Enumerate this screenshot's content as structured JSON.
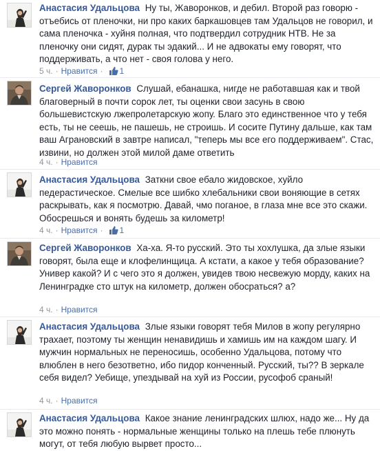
{
  "comments": [
    {
      "author": "Анастасия Удальцова",
      "text": "Ну ты, Жаворонков, и дебил. Второй раз говорю - отъебись от пленочки, ни про каких баркашовцев там Удальцов не говорил, и сама пленочка - хуйня полная, что подтвердил сотрудник НТВ. Не за пленочку они сидят, дурак ты эдакий... И не адвокаты ему говорят, что поддерживать, а что нет - своя голова у него.",
      "time": "5 ч.",
      "like_label": "Нравится",
      "like_count": "1",
      "avatar_icon": "woman-portrait-icon"
    },
    {
      "author": "Сергей Жаворонков",
      "text": "Слушай, ебанашка, нигде не работавшая как и твой благоверный в почти сорок лет, ты оценки свои засунь в свою большевистскую лжепролетарскую жопу. Благо это единственное что у тебя есть, ты не сеешь, не пашешь, не строишь. И сосите Путину дальше, как там ваш Аграновский в завтре написал, \"теперь мы все его поддерживаем\". Стас, извини, но должен этой милой даме ответить",
      "time": "4 ч.",
      "like_label": "Нравится",
      "like_count": "",
      "avatar_icon": "man-portrait-icon"
    },
    {
      "author": "Анастасия Удальцова",
      "text": "Заткни свое ебало жидовское, хуйло педерастическое. Смелые все шибко хлебальники свои воняющие в сетях раскрывать, как я посмотрю. Давай, чмо поганое, в глаза мне все это скажи. Обосрешься и вонять будешь за километр!",
      "time": "4 ч.",
      "like_label": "Нравится",
      "like_count": "1",
      "avatar_icon": "woman-portrait-icon"
    },
    {
      "author": "Сергей Жаворонков",
      "text": "Ха-ха. Я-то русский. Это ты хохлушка, да злые языки говорят, была еще и клофелинщица. А кстати, а какое у тебя образование? Универ какой? И с чего это я должен, увидев твою несвежую морду, каких на Ленинградке сто штук на километр, должен обосраться? а?",
      "time": "4 ч.",
      "like_label": "Нравится",
      "like_count": "",
      "avatar_icon": "man-portrait-icon"
    },
    {
      "author": "Анастасия Удальцова",
      "text": "Злые языки говорят тебя Милов в жопу регулярно трахает, поэтому ты женщин ненавидишь и хамишь им на каждом шагу. И мужчин нормальных не переносишь, особенно Удальцова, потому что влюблен в него безответно, ибо пидор конченный. Русский, ты?? В зеркале себя видел? Уебище, упездывай на хуй из России, русофоб сраный!",
      "time": "4 ч.",
      "like_label": "Нравится",
      "like_count": "",
      "avatar_icon": "woman-portrait-icon"
    },
    {
      "author": "Анастасия Удальцова",
      "text": "Какое знание ленинградских шлюх, надо же... Ну да это можно понять - нормальные женщины только на плешь тебе плюнуть могут, от тебя любую вырвет просто...",
      "time": "",
      "like_label": "",
      "like_count": "",
      "avatar_icon": "woman-portrait-icon"
    }
  ],
  "colors": {
    "author": "#365899",
    "text": "#1d2129",
    "meta": "#90949c",
    "like": "#4b6ea9"
  }
}
